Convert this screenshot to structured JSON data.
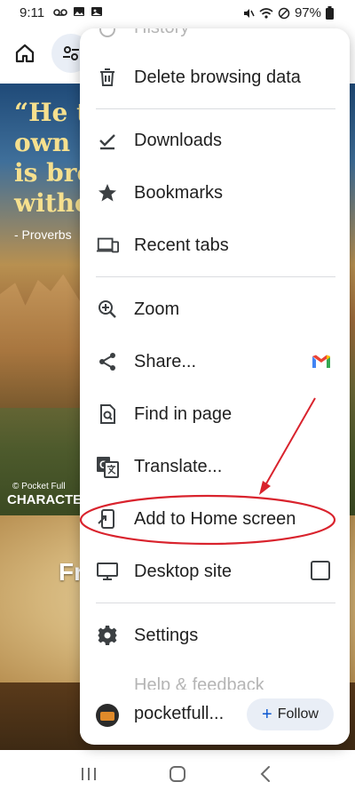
{
  "status": {
    "time": "9:11",
    "battery": "97%"
  },
  "page": {
    "quote_lines": [
      "“He th",
      "own sp",
      "is brok",
      "withou"
    ],
    "attribution": "- Proverbs",
    "copyright": "© Pocket Full",
    "brand": "CHARACTER",
    "parchment_text": "Fr"
  },
  "menu": {
    "partial_top": "History",
    "items": [
      {
        "id": "delete",
        "label": "Delete browsing data",
        "icon": "trash-icon"
      },
      {
        "id": "downloads",
        "label": "Downloads",
        "icon": "download-check-icon"
      },
      {
        "id": "bookmarks",
        "label": "Bookmarks",
        "icon": "star-icon"
      },
      {
        "id": "recent",
        "label": "Recent tabs",
        "icon": "devices-icon"
      },
      {
        "id": "zoom",
        "label": "Zoom",
        "icon": "zoom-in-icon"
      },
      {
        "id": "share",
        "label": "Share...",
        "icon": "share-icon"
      },
      {
        "id": "find",
        "label": "Find in page",
        "icon": "find-in-page-icon"
      },
      {
        "id": "translate",
        "label": "Translate...",
        "icon": "translate-icon"
      },
      {
        "id": "addhome",
        "label": "Add to Home screen",
        "icon": "add-to-home-icon"
      },
      {
        "id": "desktop",
        "label": "Desktop site",
        "icon": "monitor-icon"
      },
      {
        "id": "settings",
        "label": "Settings",
        "icon": "gear-icon"
      }
    ],
    "partial_bottom": "Help & feedback",
    "site_label": "pocketfull...",
    "follow_label": "Follow",
    "desktop_site_checked": false
  },
  "colors": {
    "annotation": "#d9232d",
    "follow_bg": "#e9eef6",
    "accent": "#0b57d0"
  }
}
